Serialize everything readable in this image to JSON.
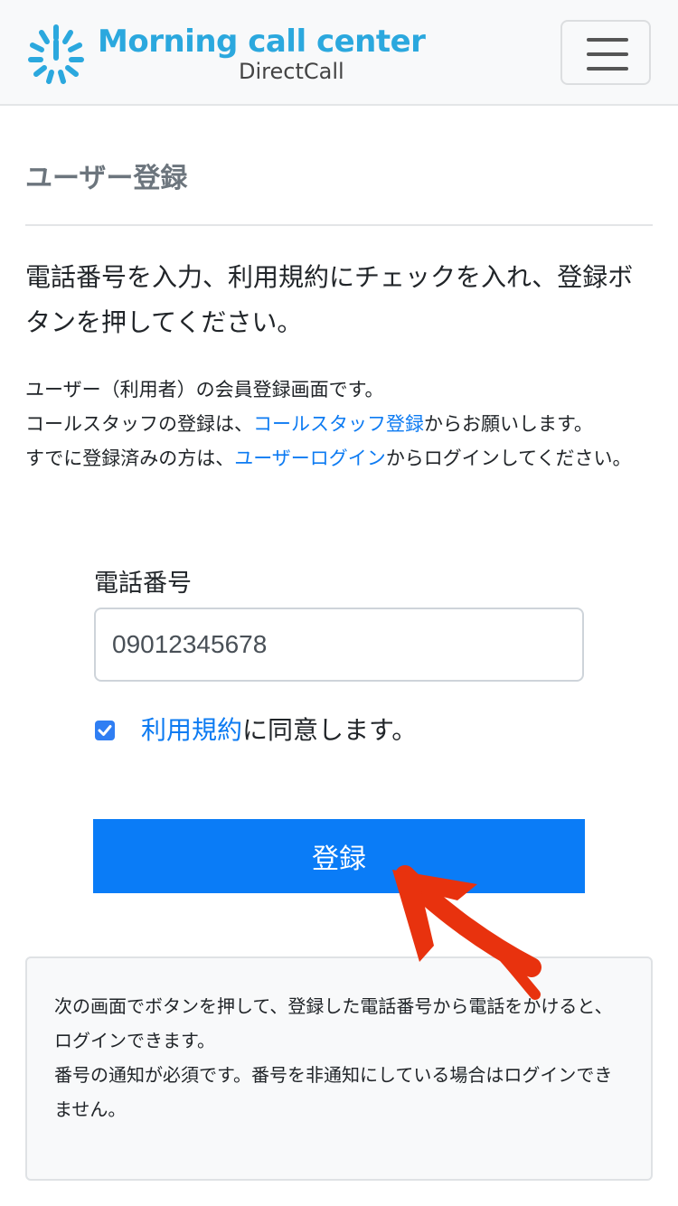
{
  "navbar": {
    "brand_title": "Morning call center",
    "brand_subtitle": "DirectCall",
    "brand_color": "#2ba8de"
  },
  "page": {
    "title": "ユーザー登録"
  },
  "lead": "電話番号を入力、利用規約にチェックを入れ、登録ボタンを押してください。",
  "info": {
    "line1": "ユーザー（利用者）の会員登録画面です。",
    "line2_prefix": "コールスタッフの登録は、",
    "line2_link": "コールスタッフ登録",
    "line2_suffix": "からお願いします。",
    "line3_prefix": "すでに登録済みの方は、",
    "line3_link": "ユーザーログイン",
    "line3_suffix": "からログインしてください。"
  },
  "form": {
    "phone_label": "電話番号",
    "phone_value": "09012345678",
    "agree_checked": true,
    "agree_link": "利用規約",
    "agree_suffix": "に同意します。",
    "submit_label": "登録",
    "accent_color": "#0a7cf7"
  },
  "notice": {
    "line1": "次の画面でボタンを押して、登録した電話番号から電話をかけると、ログインできます。",
    "line2": "番号の通知が必須です。番号を非通知にしている場合はログインできません。"
  },
  "annotation": {
    "arrow_color": "#e8320e"
  }
}
